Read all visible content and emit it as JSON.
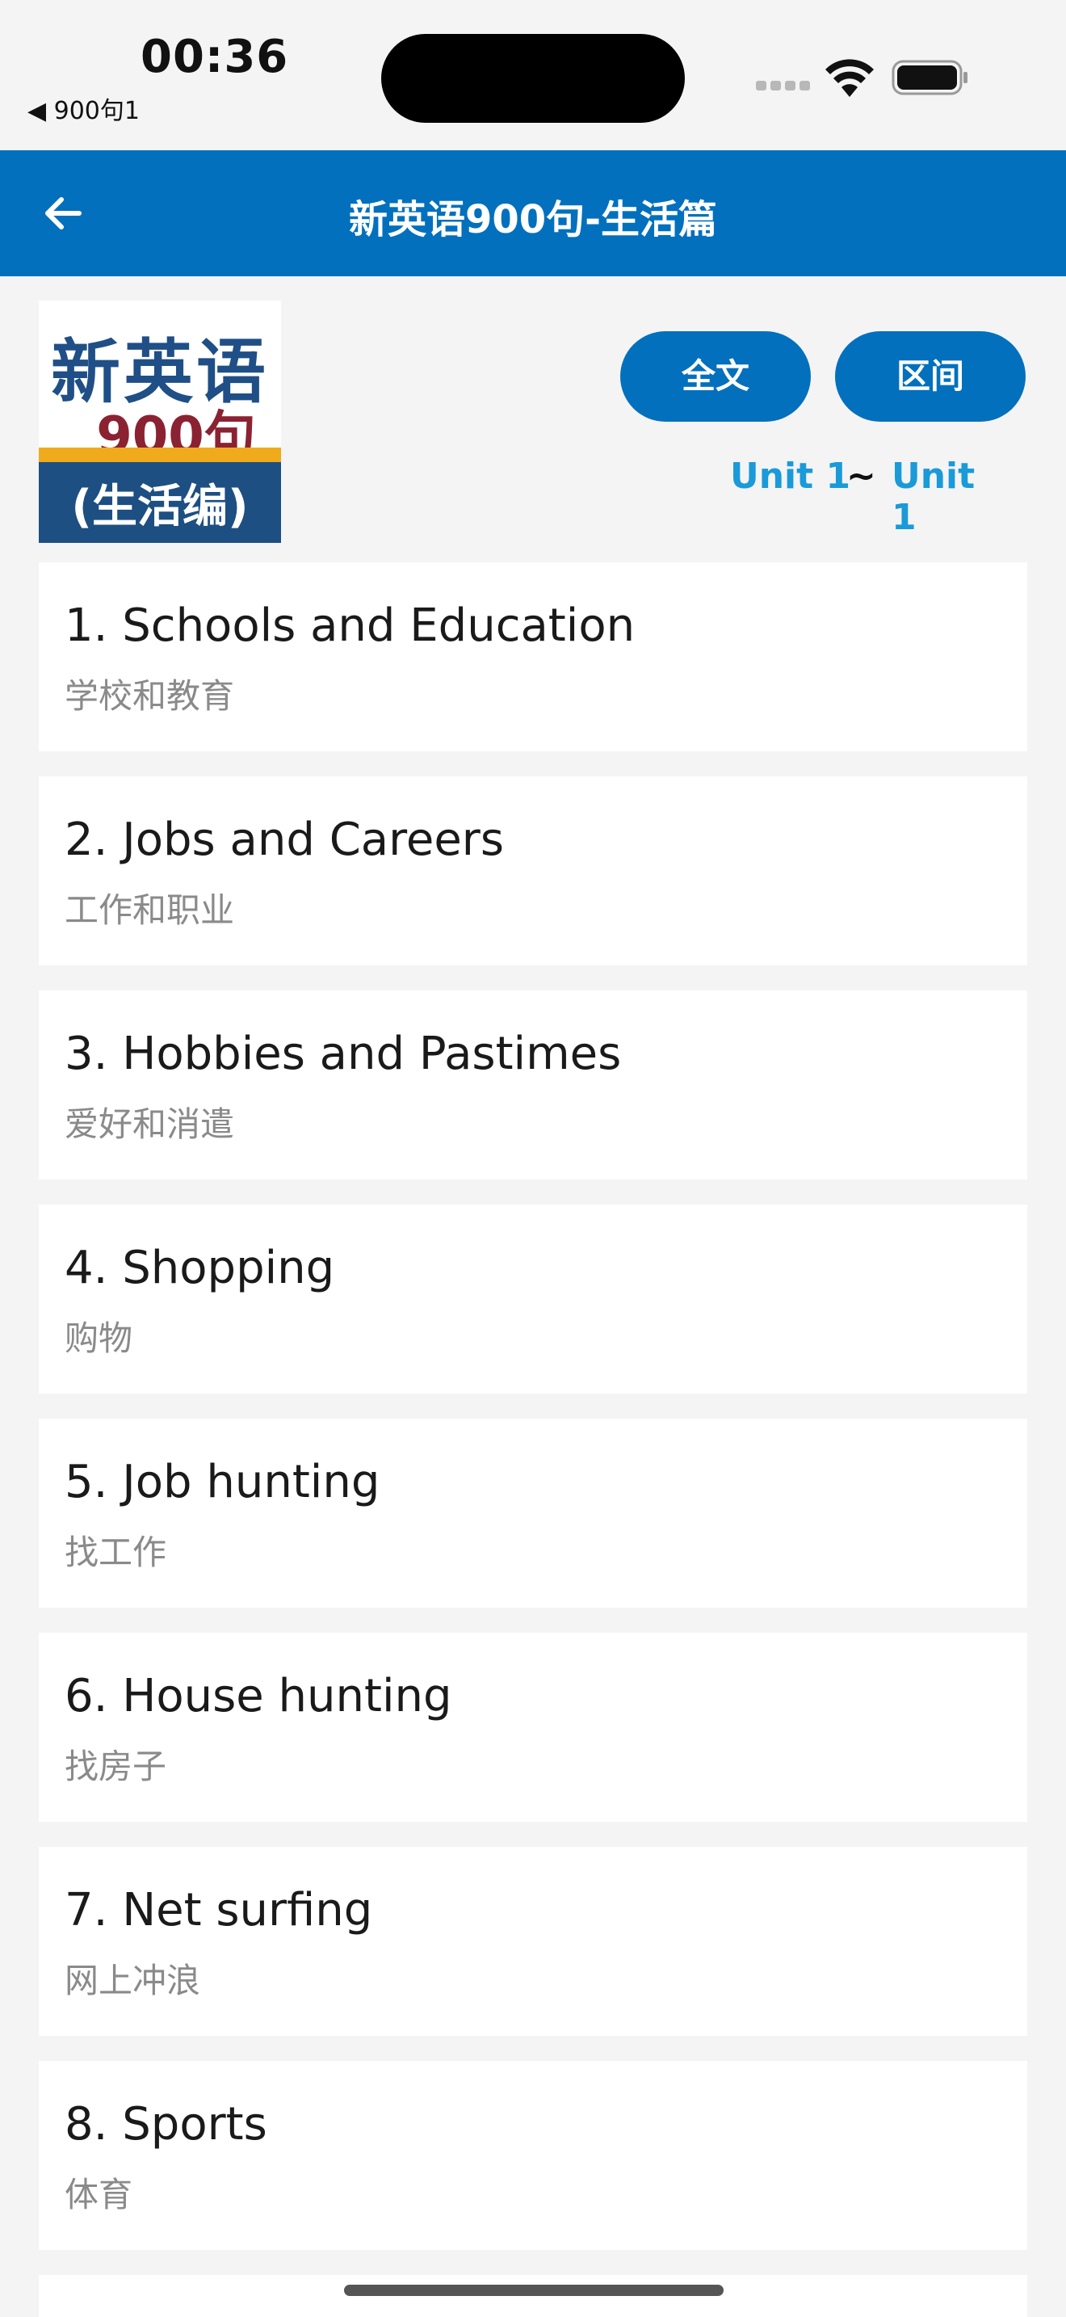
{
  "status_bar": {
    "time": "00:36",
    "back_app": "◀ 900句1"
  },
  "header": {
    "back_icon": "arrow-left-icon",
    "title": "新英语900句-生活篇"
  },
  "cover": {
    "line1": "新英语",
    "line2": "900句",
    "line3": "(生活编)"
  },
  "buttons": {
    "full_text": "全文",
    "range": "区间"
  },
  "range": {
    "from": "Unit 1",
    "separator": "~",
    "to": "Unit 1"
  },
  "colors": {
    "accent": "#0270bd",
    "link": "#1a9ad8",
    "background": "#f4f4f4"
  },
  "units": [
    {
      "title": "1. Schools and Education",
      "subtitle": "学校和教育"
    },
    {
      "title": "2. Jobs and Careers",
      "subtitle": "工作和职业"
    },
    {
      "title": "3. Hobbies and Pastimes",
      "subtitle": "爱好和消遣"
    },
    {
      "title": "4. Shopping",
      "subtitle": "购物"
    },
    {
      "title": "5. Job hunting",
      "subtitle": "找工作"
    },
    {
      "title": "6. House hunting",
      "subtitle": "找房子"
    },
    {
      "title": "7. Net surfing",
      "subtitle": "网上冲浪"
    },
    {
      "title": "8. Sports",
      "subtitle": "体育"
    }
  ]
}
